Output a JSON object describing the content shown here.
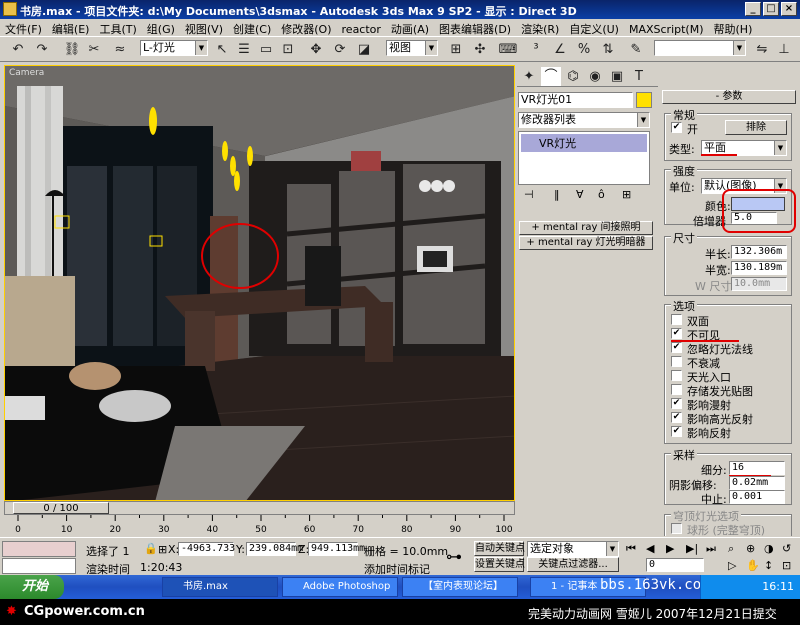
{
  "window": {
    "title": "书房.max  - 项目文件夹: d:\\My Documents\\3dsmax   - Autodesk 3ds Max 9 SP2    - 显示 : Direct 3D"
  },
  "menu": [
    "文件(F)",
    "编辑(E)",
    "工具(T)",
    "组(G)",
    "视图(V)",
    "创建(C)",
    "修改器(O)",
    "reactor",
    "动画(A)",
    "图表编辑器(D)",
    "渲染(R)",
    "自定义(U)",
    "MAXScript(M)",
    "帮助(H)"
  ],
  "toolbar": {
    "selection_filter": "L-灯光",
    "ref_coord": "视图"
  },
  "viewport": {
    "label": "Camera"
  },
  "modify_panel": {
    "object_name": "VR灯光01",
    "modifier_list": "修改器列表",
    "stack_item": "VR灯光",
    "mental_ray_buttons": [
      "mental ray 间接照明",
      "mental ray 灯光明暗器"
    ]
  },
  "params": {
    "header": "参数",
    "general": {
      "title": "常规",
      "on_label": "开",
      "on": true,
      "exclude": "排除",
      "type_label": "类型:",
      "type_value": "平面"
    },
    "intensity": {
      "title": "强度",
      "units_label": "单位:",
      "units_value": "默认(图像)",
      "color_label": "颜色:",
      "color": "#b9c8f4",
      "multiplier_label": "倍增器",
      "multiplier": "5.0"
    },
    "size": {
      "title": "尺寸",
      "half_length_label": "半长:",
      "half_length": "132.306m",
      "half_width_label": "半宽:",
      "half_width": "130.189m",
      "w_size_label": "W 尺寸",
      "w_size": "10.0mm"
    },
    "options": {
      "title": "选项",
      "items": [
        {
          "label": "双面",
          "checked": false
        },
        {
          "label": "不可见",
          "checked": true
        },
        {
          "label": "忽略灯光法线",
          "checked": true
        },
        {
          "label": "不衰减",
          "checked": false
        },
        {
          "label": "天光入口",
          "checked": false
        },
        {
          "label": "存储发光贴图",
          "checked": false
        },
        {
          "label": "影响漫射",
          "checked": true
        },
        {
          "label": "影响高光反射",
          "checked": true
        },
        {
          "label": "影响反射",
          "checked": true
        }
      ]
    },
    "sampling": {
      "title": "采样",
      "subdivs_label": "细分:",
      "subdivs": "16",
      "shadow_bias_label": "阴影偏移:",
      "shadow_bias": "0.02mm",
      "cutoff_label": "中止:",
      "cutoff": "0.001"
    },
    "dome": {
      "title": "穹顶灯光选项",
      "sphere_label": "球形 (完整穹顶)"
    }
  },
  "timeline": {
    "position": "0 / 100",
    "ticks": [
      "0",
      "10",
      "20",
      "30",
      "40",
      "50",
      "60",
      "70",
      "80",
      "90",
      "100"
    ]
  },
  "status": {
    "selected": "选择了 1",
    "x_label": "X:",
    "x": "-4963.733",
    "y_label": "Y:",
    "y": "239.084mm",
    "z_label": "Z:",
    "z": "949.113mm",
    "grid": "栅格 = 10.0mm",
    "auto_key": "自动关键点",
    "set_key": "设置关键点",
    "key_filter": "关键点过滤器...",
    "selection_set": "选定对象",
    "frame": "0",
    "render_time_label": "渲染时间",
    "render_time": "1:20:43",
    "add_time_tag": "添加时间标记"
  },
  "taskbar": {
    "start": "开始",
    "tasks": [
      "书房.max",
      "Adobe Photoshop",
      "【室内表现论坛】",
      "1 - 记事本"
    ],
    "watermark": "bbs.163vk.com",
    "clock": "16:11"
  },
  "footer": {
    "left": "CGpower.com.cn",
    "right": "完美动力动画网 雪姬儿 2007年12月21日提交"
  }
}
